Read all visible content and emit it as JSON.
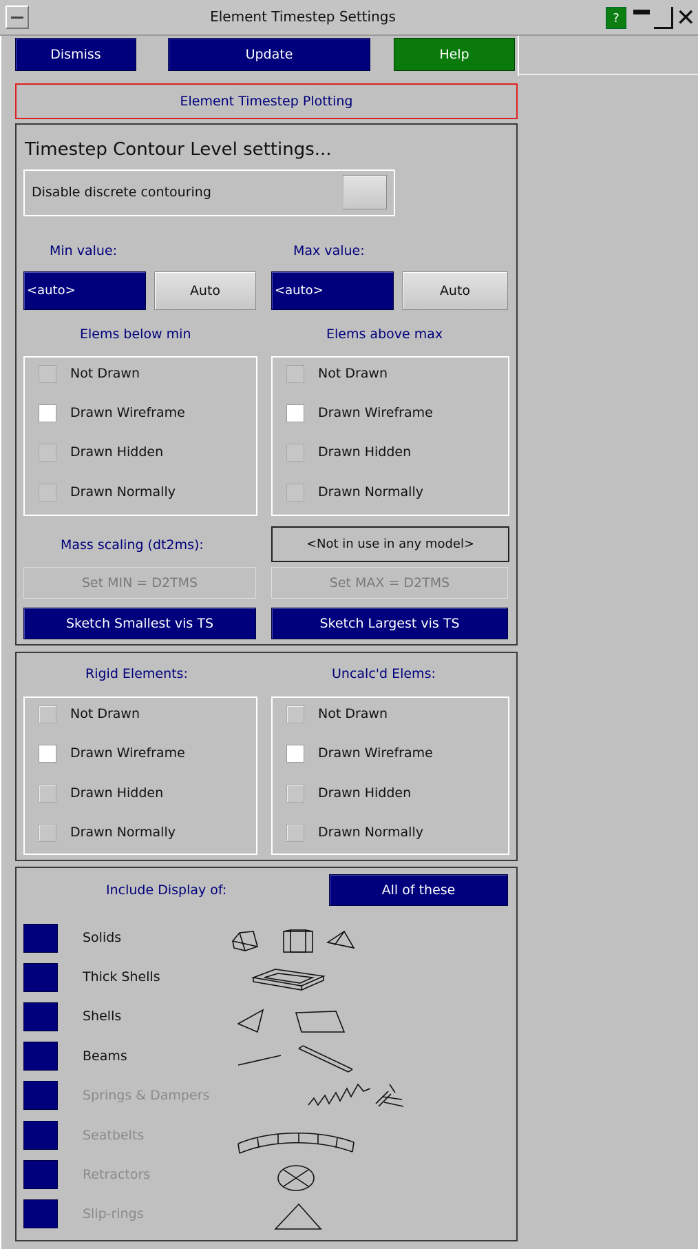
{
  "window": {
    "title": "Element Timestep Settings",
    "help_glyph": "?"
  },
  "top_buttons": {
    "dismiss": "Dismiss",
    "update": "Update",
    "help": "Help"
  },
  "section_button": "Element Timestep Plotting",
  "contour": {
    "heading": "Timestep Contour Level settings...",
    "disable_label": "Disable discrete contouring",
    "min_label": "Min value:",
    "max_label": "Max value:",
    "min_value": "<auto>",
    "max_value": "<auto>",
    "auto_label": "Auto",
    "below_min_title": "Elems below min",
    "above_max_title": "Elems above max",
    "options": [
      "Not Drawn",
      "Drawn Wireframe",
      "Drawn Hidden",
      "Drawn Normally"
    ],
    "selected_option": "Drawn Wireframe",
    "mass_scaling_label": "Mass scaling (dt2ms):",
    "mass_scaling_status": "<Not in use in any model>",
    "set_min_label": "Set MIN = D2TMS",
    "set_max_label": "Set MAX = D2TMS",
    "sketch_smallest": "Sketch Smallest vis TS",
    "sketch_largest": "Sketch Largest vis TS"
  },
  "special": {
    "rigid_title": "Rigid Elements:",
    "uncalc_title": "Uncalc'd Elems:",
    "options": [
      "Not Drawn",
      "Drawn Wireframe",
      "Drawn Hidden",
      "Drawn Normally"
    ],
    "selected_option": "Drawn Wireframe"
  },
  "include": {
    "title": "Include Display of:",
    "all_button": "All of these",
    "items": [
      {
        "label": "Solids",
        "enabled": true,
        "icon": "solids-icon"
      },
      {
        "label": "Thick Shells",
        "enabled": true,
        "icon": "thick-shell-icon"
      },
      {
        "label": "Shells",
        "enabled": true,
        "icon": "shells-icon"
      },
      {
        "label": "Beams",
        "enabled": true,
        "icon": "beams-icon"
      },
      {
        "label": "Springs & Dampers",
        "enabled": false,
        "icon": "spring-damper-icon"
      },
      {
        "label": "Seatbelts",
        "enabled": false,
        "icon": "seatbelt-icon"
      },
      {
        "label": "Retractors",
        "enabled": false,
        "icon": "retractor-icon"
      },
      {
        "label": "Slip-rings",
        "enabled": false,
        "icon": "slipring-icon"
      }
    ]
  },
  "colors": {
    "navy": "#00007c",
    "green": "#0a7a0c",
    "panel_bg": "#c0c0c0",
    "label_blue": "#00007c",
    "focus_red": "#e02020"
  }
}
